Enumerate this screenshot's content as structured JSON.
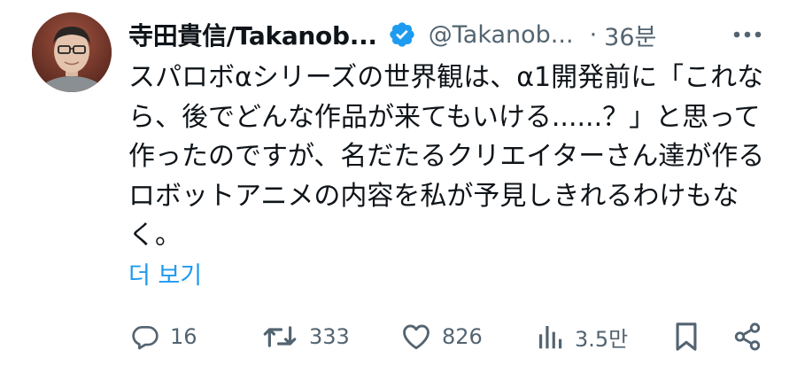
{
  "author": {
    "display_name": "寺田貴信/Takanob...",
    "handle": "@Takanob...",
    "separator": "·",
    "time": "36분"
  },
  "post": {
    "text": "スパロボαシリーズの世界観は、α1開発前に「これなら、後でどんな作品が来てもいける......？」と思って作ったのですが、名だたるクリエイターさん達が作るロボットアニメの内容を私が予見しきれるわけもなく。",
    "show_more": "더 보기"
  },
  "actions": {
    "replies": "16",
    "reposts": "333",
    "likes": "826",
    "views": "3.5만"
  },
  "colors": {
    "text": "#0f1419",
    "secondary": "#536471",
    "accent": "#1d9bf0"
  },
  "icons": {
    "verified": "verified-badge-icon",
    "more": "more-icon",
    "reply": "reply-icon",
    "repost": "repost-icon",
    "like": "like-icon",
    "views": "views-icon",
    "bookmark": "bookmark-icon",
    "share": "share-icon"
  }
}
